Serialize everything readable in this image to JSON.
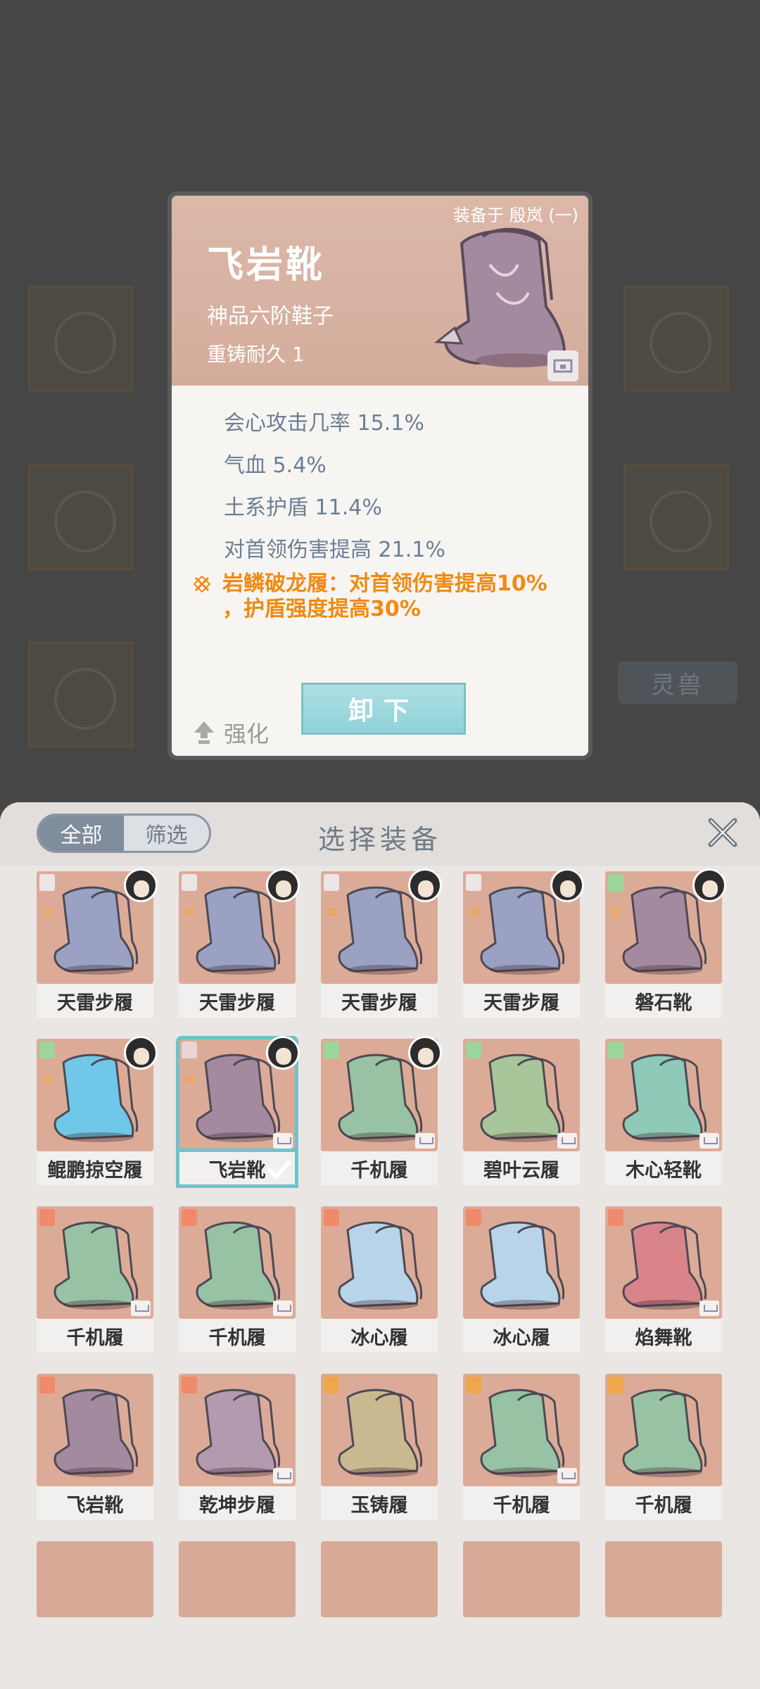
{
  "background": {
    "side_tag": "灵兽"
  },
  "detail": {
    "equipped_label": "装备于 殷岚 (一)",
    "name": "飞岩靴",
    "grade": "神品六阶鞋子",
    "durability": "重铸耐久 1",
    "stats": [
      {
        "text": "会心攻击几率 15.1%",
        "color": "#e07aa0"
      },
      {
        "text": "气血 5.4%",
        "color": "#bdbdbd"
      },
      {
        "text": "土系护盾 11.4%",
        "color": "#bdbdbd"
      },
      {
        "text": "对首领伤害提高 21.1%",
        "color": "#6fb6dc"
      }
    ],
    "set_bonus_line1": "岩鳞破龙履：对首领伤害提高10%",
    "set_bonus_line2": "，护盾强度提高30%",
    "strengthen_label": "强化",
    "unequip_label": "卸下"
  },
  "panel": {
    "filter_all": "全部",
    "filter_screen": "筛选",
    "title": "选择装备",
    "items": [
      {
        "name": "天雷步履"
      },
      {
        "name": "天雷步履"
      },
      {
        "name": "天雷步履"
      },
      {
        "name": "天雷步履"
      },
      {
        "name": "磐石靴"
      },
      {
        "name": "鲲鹏掠空履"
      },
      {
        "name": "飞岩靴"
      },
      {
        "name": "千机履"
      },
      {
        "name": "碧叶云履"
      },
      {
        "name": "木心轻靴"
      },
      {
        "name": "千机履"
      },
      {
        "name": "千机履"
      },
      {
        "name": "冰心履"
      },
      {
        "name": "冰心履"
      },
      {
        "name": "焰舞靴"
      },
      {
        "name": "飞岩靴"
      },
      {
        "name": "乾坤步履"
      },
      {
        "name": "玉铸履"
      },
      {
        "name": "千机履"
      },
      {
        "name": "千机履"
      }
    ]
  },
  "colors": {
    "accent_teal": "#6ec3c9",
    "set_orange": "#f08a12",
    "card_bg": "#dcab98"
  }
}
